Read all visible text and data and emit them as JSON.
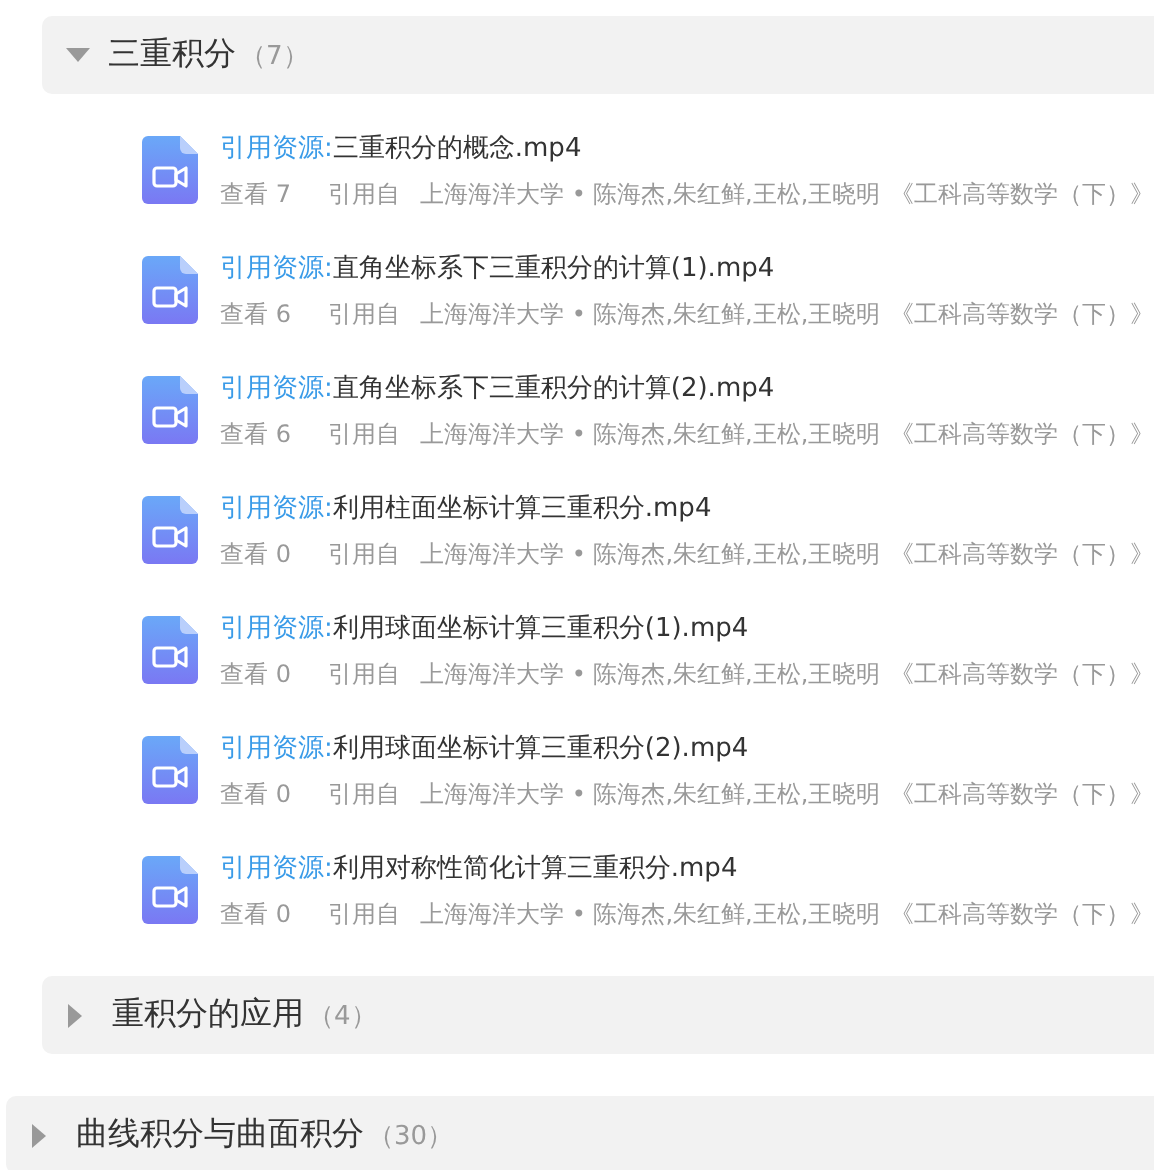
{
  "chapters": [
    {
      "sections": [
        {
          "title": "三重积分",
          "count": "（7）",
          "expanded": true,
          "items": [
            {
              "prefix": "引用资源:",
              "name": "三重积分的概念.mp4",
              "views": "查看 7",
              "cited_label": "引用自",
              "source": "上海海洋大学 • 陈海杰,朱红鲜,王松,王晓明",
              "book": "《工科高等数学（下）》"
            },
            {
              "prefix": "引用资源:",
              "name": "直角坐标系下三重积分的计算(1).mp4",
              "views": "查看 6",
              "cited_label": "引用自",
              "source": "上海海洋大学 • 陈海杰,朱红鲜,王松,王晓明",
              "book": "《工科高等数学（下）》"
            },
            {
              "prefix": "引用资源:",
              "name": "直角坐标系下三重积分的计算(2).mp4",
              "views": "查看 6",
              "cited_label": "引用自",
              "source": "上海海洋大学 • 陈海杰,朱红鲜,王松,王晓明",
              "book": "《工科高等数学（下）》"
            },
            {
              "prefix": "引用资源:",
              "name": "利用柱面坐标计算三重积分.mp4",
              "views": "查看 0",
              "cited_label": "引用自",
              "source": "上海海洋大学 • 陈海杰,朱红鲜,王松,王晓明",
              "book": "《工科高等数学（下）》"
            },
            {
              "prefix": "引用资源:",
              "name": "利用球面坐标计算三重积分(1).mp4",
              "views": "查看 0",
              "cited_label": "引用自",
              "source": "上海海洋大学 • 陈海杰,朱红鲜,王松,王晓明",
              "book": "《工科高等数学（下）》"
            },
            {
              "prefix": "引用资源:",
              "name": "利用球面坐标计算三重积分(2).mp4",
              "views": "查看 0",
              "cited_label": "引用自",
              "source": "上海海洋大学 • 陈海杰,朱红鲜,王松,王晓明",
              "book": "《工科高等数学（下）》"
            },
            {
              "prefix": "引用资源:",
              "name": "利用对称性简化计算三重积分.mp4",
              "views": "查看 0",
              "cited_label": "引用自",
              "source": "上海海洋大学 • 陈海杰,朱红鲜,王松,王晓明",
              "book": "《工科高等数学（下）》"
            }
          ]
        },
        {
          "title": "重积分的应用",
          "count": "（4）",
          "expanded": false
        }
      ]
    },
    {
      "title": "曲线积分与曲面积分",
      "count": "（30）",
      "expanded": false
    }
  ]
}
